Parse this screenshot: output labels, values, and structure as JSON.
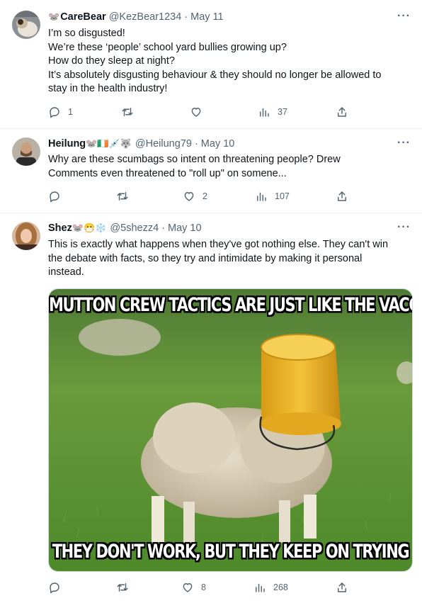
{
  "tweets": [
    {
      "name": "CareBear",
      "name_prefix_emoji": "🐭",
      "name_suffix_emojis": "",
      "handle": "@KezBear1234",
      "date": "· May 11",
      "lines": [
        "I’m so disgusted!",
        "We’re these ‘people’ school yard bullies growing up?",
        "How do they sleep at night?",
        "It’s absolutely disgusting behaviour & they should no longer be allowed to",
        "stay in the health industry!"
      ],
      "replies": "1",
      "retweets": "",
      "likes": "",
      "views": "37"
    },
    {
      "name": "Heilung",
      "name_prefix_emoji": "",
      "name_suffix_emojis": "🐭🇮🇪💉🐺",
      "handle": "@Heilung79",
      "date": "· May 10",
      "lines": [
        "Why are these scumbags so intent on threatening people?  Drew",
        "Comments even threatened to \"roll up\" on somene..."
      ],
      "replies": "",
      "retweets": "",
      "likes": "2",
      "views": "107"
    },
    {
      "name": "Shez",
      "name_prefix_emoji": "",
      "name_suffix_emojis": "🐭😷❄️",
      "handle": "@5shezz4",
      "date": "· May 10",
      "lines": [
        "This is exactly what happens when they've got nothing else. They can't win",
        "the debate with facts, so they try and intimidate by making it personal",
        "instead."
      ],
      "meme": {
        "top_caption": "MUTTON CREW TACTICS ARE JUST LIKE THE VACCINE...",
        "bottom_caption": "THEY DON'T WORK, BUT THEY KEEP ON TRYING"
      },
      "replies": "",
      "retweets": "",
      "likes": "8",
      "views": "268"
    }
  ],
  "more_label": "···",
  "icons": [
    "reply-icon",
    "retweet-icon",
    "like-icon",
    "views-icon",
    "share-icon"
  ],
  "colors": {
    "text": "#0f1419",
    "muted": "#536471",
    "border": "#eff3f4"
  }
}
